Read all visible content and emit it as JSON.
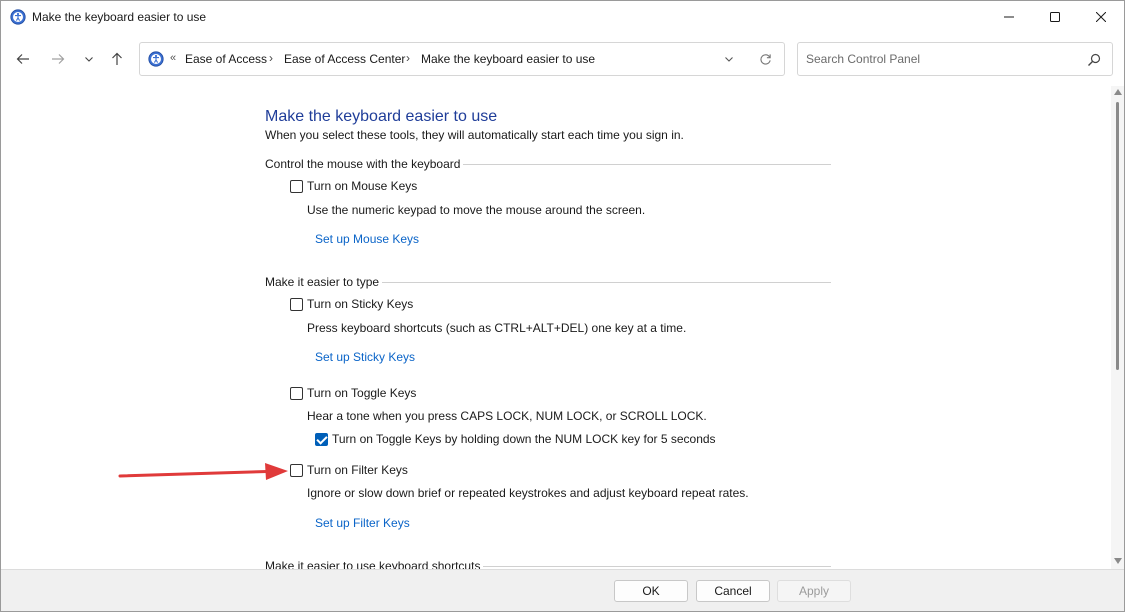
{
  "window": {
    "title": "Make the keyboard easier to use"
  },
  "address_bar": {
    "chevron": "«",
    "crumbs": [
      "Ease of Access",
      "Ease of Access Center",
      "Make the keyboard easier to use"
    ],
    "separator": "›"
  },
  "search": {
    "placeholder": "Search Control Panel",
    "value": ""
  },
  "page": {
    "heading": "Make the keyboard easier to use",
    "subheading": "When you select these tools, they will automatically start each time you sign in."
  },
  "sections": {
    "mouse": {
      "label": "Control the mouse with the keyboard",
      "mouse_keys": {
        "label": "Turn on Mouse Keys",
        "checked": false,
        "description": "Use the numeric keypad to move the mouse around the screen.",
        "link": "Set up Mouse Keys"
      }
    },
    "typing": {
      "label": "Make it easier to type",
      "sticky_keys": {
        "label": "Turn on Sticky Keys",
        "checked": false,
        "description": "Press keyboard shortcuts (such as CTRL+ALT+DEL) one key at a time.",
        "link": "Set up Sticky Keys"
      },
      "toggle_keys": {
        "label": "Turn on Toggle Keys",
        "checked": false,
        "description": "Hear a tone when you press CAPS LOCK, NUM LOCK, or SCROLL LOCK.",
        "sub_option": {
          "label": "Turn on Toggle Keys by holding down the NUM LOCK key for 5 seconds",
          "checked": true
        }
      },
      "filter_keys": {
        "label": "Turn on Filter Keys",
        "checked": false,
        "description": "Ignore or slow down brief or repeated keystrokes and adjust keyboard repeat rates.",
        "link": "Set up Filter Keys"
      }
    },
    "shortcuts": {
      "label": "Make it easier to use keyboard shortcuts"
    }
  },
  "footer": {
    "ok": "OK",
    "cancel": "Cancel",
    "apply": "Apply"
  },
  "colors": {
    "heading": "#1f3d99",
    "link": "#0a64c8",
    "checkbox_checked": "#005fb8",
    "annotation_arrow": "#e03a3a"
  }
}
